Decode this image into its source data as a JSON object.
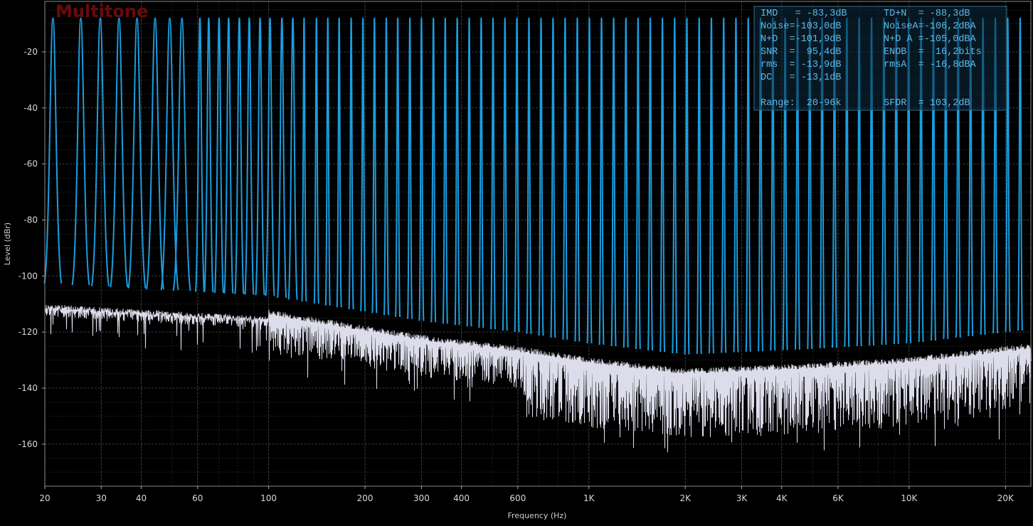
{
  "chart_data": {
    "type": "line",
    "title": "Multitone",
    "xlabel": "Frequency (Hz)",
    "ylabel": "Level (dBr)",
    "x_scale": "log",
    "xlim": [
      20,
      24000
    ],
    "ylim": [
      -175,
      -2
    ],
    "grid": true,
    "x_ticks": [
      {
        "value": 20,
        "label": "20"
      },
      {
        "value": 30,
        "label": "30"
      },
      {
        "value": 40,
        "label": "40"
      },
      {
        "value": 60,
        "label": "60"
      },
      {
        "value": 100,
        "label": "100"
      },
      {
        "value": 200,
        "label": "200"
      },
      {
        "value": 300,
        "label": "300"
      },
      {
        "value": 400,
        "label": "400"
      },
      {
        "value": 600,
        "label": "600"
      },
      {
        "value": 1000,
        "label": "1K"
      },
      {
        "value": 2000,
        "label": "2K"
      },
      {
        "value": 3000,
        "label": "3K"
      },
      {
        "value": 4000,
        "label": "4K"
      },
      {
        "value": 6000,
        "label": "6K"
      },
      {
        "value": 10000,
        "label": "10K"
      },
      {
        "value": 20000,
        "label": "20K"
      }
    ],
    "y_ticks": [
      {
        "value": -20,
        "label": "-20"
      },
      {
        "value": -40,
        "label": "-40"
      },
      {
        "value": -60,
        "label": "-60"
      },
      {
        "value": -80,
        "label": "-80"
      },
      {
        "value": -100,
        "label": "-100"
      },
      {
        "value": -120,
        "label": "-120"
      },
      {
        "value": -140,
        "label": "-140"
      },
      {
        "value": -160,
        "label": "-160"
      }
    ],
    "series": [
      {
        "name": "Multitone",
        "color": "#1a9ee0",
        "tone_level": -8,
        "tone_frequencies": [
          21.2,
          25.9,
          29.8,
          34.1,
          38.8,
          44.2,
          49.1,
          53.6,
          61,
          65,
          70,
          75,
          81,
          87,
          94,
          101,
          110,
          119,
          129,
          141,
          153,
          166,
          181,
          197,
          214,
          233,
          253,
          276,
          300,
          327,
          356,
          388,
          423,
          461,
          502,
          547,
          596,
          650,
          709,
          773,
          843,
          920,
          1004,
          1095,
          1195,
          1305,
          1424,
          1555,
          1697,
          1853,
          2023,
          2210,
          2413,
          2636,
          2879,
          3145,
          3436,
          3754,
          4101,
          4481,
          4896,
          5350,
          5847,
          6390,
          6984,
          7633,
          8343,
          9118,
          9966,
          10894,
          11908,
          13017,
          14230,
          15556,
          17006,
          18592,
          20325,
          22222
        ]
      },
      {
        "name": "Noise",
        "color": "#dcdcea",
        "approx_level_by_freq": [
          [
            20,
            -110.5
          ],
          [
            100,
            -115
          ],
          [
            300,
            -124
          ],
          [
            600,
            -128
          ],
          [
            1000,
            -132
          ],
          [
            2000,
            -136
          ],
          [
            5000,
            -134
          ],
          [
            10000,
            -132
          ],
          [
            20000,
            -128
          ],
          [
            24000,
            -127
          ]
        ]
      }
    ]
  },
  "stats": {
    "lines": [
      [
        "IMD   = -83,3dB",
        "TD+N  = -88,3dB"
      ],
      [
        "Noise=-103,0dB",
        "NoiseA=-106,2dBA"
      ],
      [
        "N+D  =-101,9dB",
        "N+D A =-105,0dBA"
      ],
      [
        "SNR  =  95,4dB",
        "ENOB  =  16,2bits"
      ],
      [
        "rms  = -13,9dB",
        "rmsA  = -16,8dBA"
      ],
      [
        "DC   = -13,1dB",
        ""
      ],
      [
        "",
        ""
      ],
      [
        "Range:  20-96k",
        "SFDR  = 103,2dB"
      ]
    ]
  },
  "colors": {
    "background": "#000000",
    "grid_major": "#3a3a3a",
    "grid_minor": "#1e1e1e",
    "title": "#6a0a0a",
    "stats_border": "#2f6f93",
    "stats_fill": "#0c2a3c"
  }
}
